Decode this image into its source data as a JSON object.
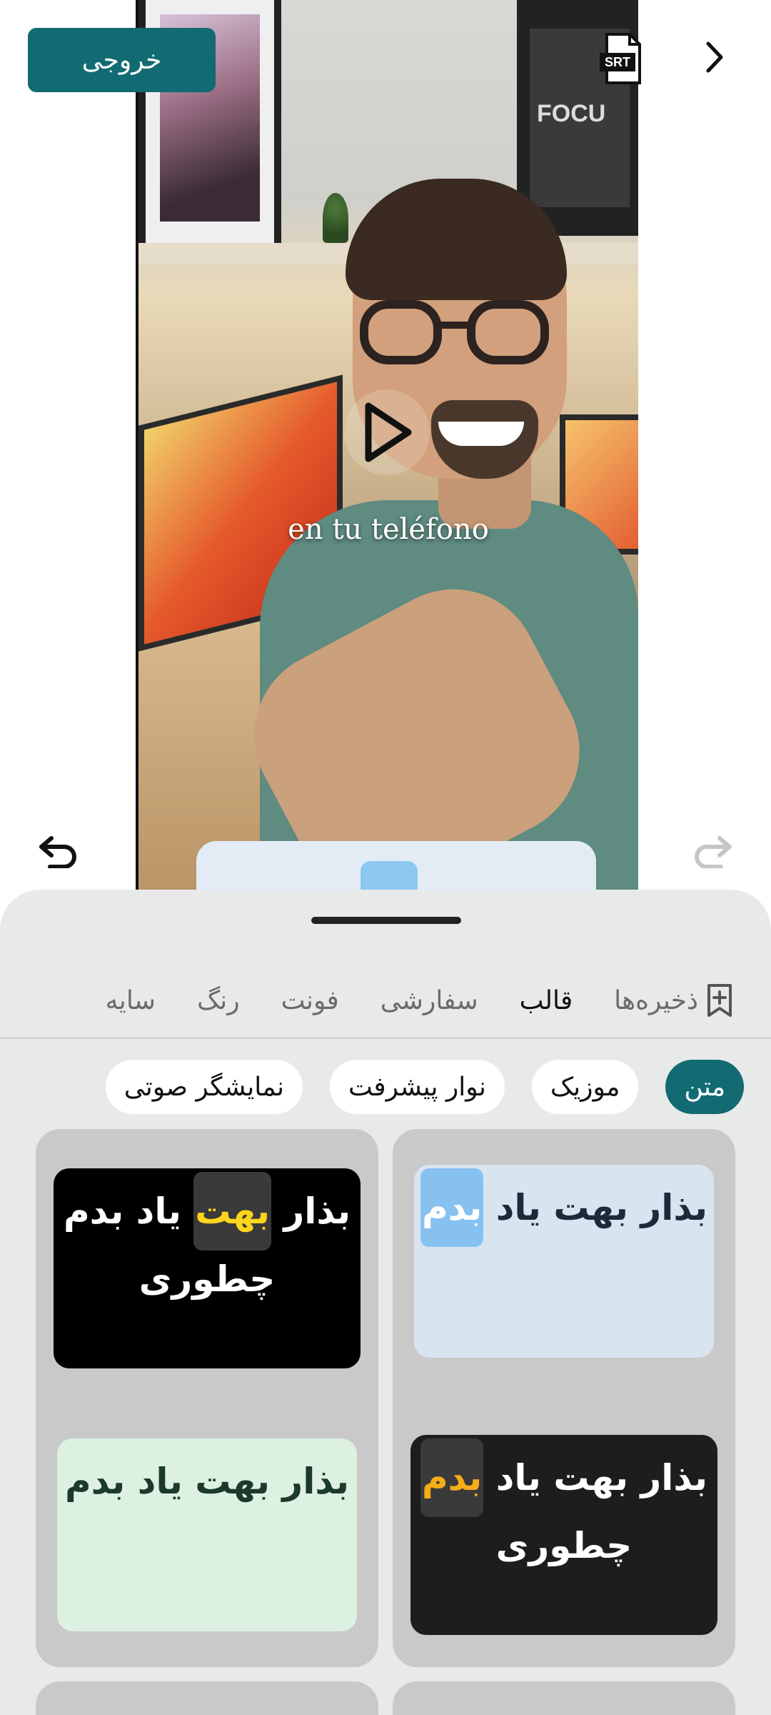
{
  "header": {
    "export_label": "خروجی",
    "srt_icon": "srt-file-icon",
    "next_icon": "chevron-right-icon"
  },
  "video": {
    "subtitle_text": "en tu teléfono",
    "play_icon": "play-icon",
    "poster_text": "FOCU"
  },
  "history": {
    "undo_icon": "undo-icon",
    "redo_icon": "redo-icon"
  },
  "sheet": {
    "tabs": [
      {
        "label": "ذخیره‌ها",
        "icon": "bookmark-add-icon",
        "active": false
      },
      {
        "label": "قالب",
        "active": true
      },
      {
        "label": "سفارشی",
        "active": false
      },
      {
        "label": "فونت",
        "active": false
      },
      {
        "label": "رنگ",
        "active": false
      },
      {
        "label": "سایه",
        "active": false
      }
    ],
    "chips": [
      {
        "label": "متن",
        "active": true
      },
      {
        "label": "موزیک",
        "active": false
      },
      {
        "label": "نوار پیشرفت",
        "active": false
      },
      {
        "label": "نمایشگر صوتی",
        "active": false
      }
    ],
    "templates": [
      {
        "line1_before": "بذار بهت یاد",
        "line1_highlight": "بدم",
        "line1_after": "",
        "line2": ""
      },
      {
        "line1_before": "بذار",
        "line1_highlight": "بهت",
        "line1_after": "یاد بدم",
        "line2": "چطوری"
      },
      {
        "line1_before": "بذار بهت یاد",
        "line1_highlight": "بدم",
        "line1_after": "",
        "line2": "چطوری"
      },
      {
        "line1_before": "بذار بهت یاد بدم",
        "line1_highlight": "",
        "line1_after": "",
        "line2": ""
      }
    ],
    "colors": {
      "accent": "#126b72",
      "highlight_blue": "#86c1f0",
      "highlight_yellow": "#ffd51c",
      "highlight_orange": "#f6ad17"
    }
  }
}
